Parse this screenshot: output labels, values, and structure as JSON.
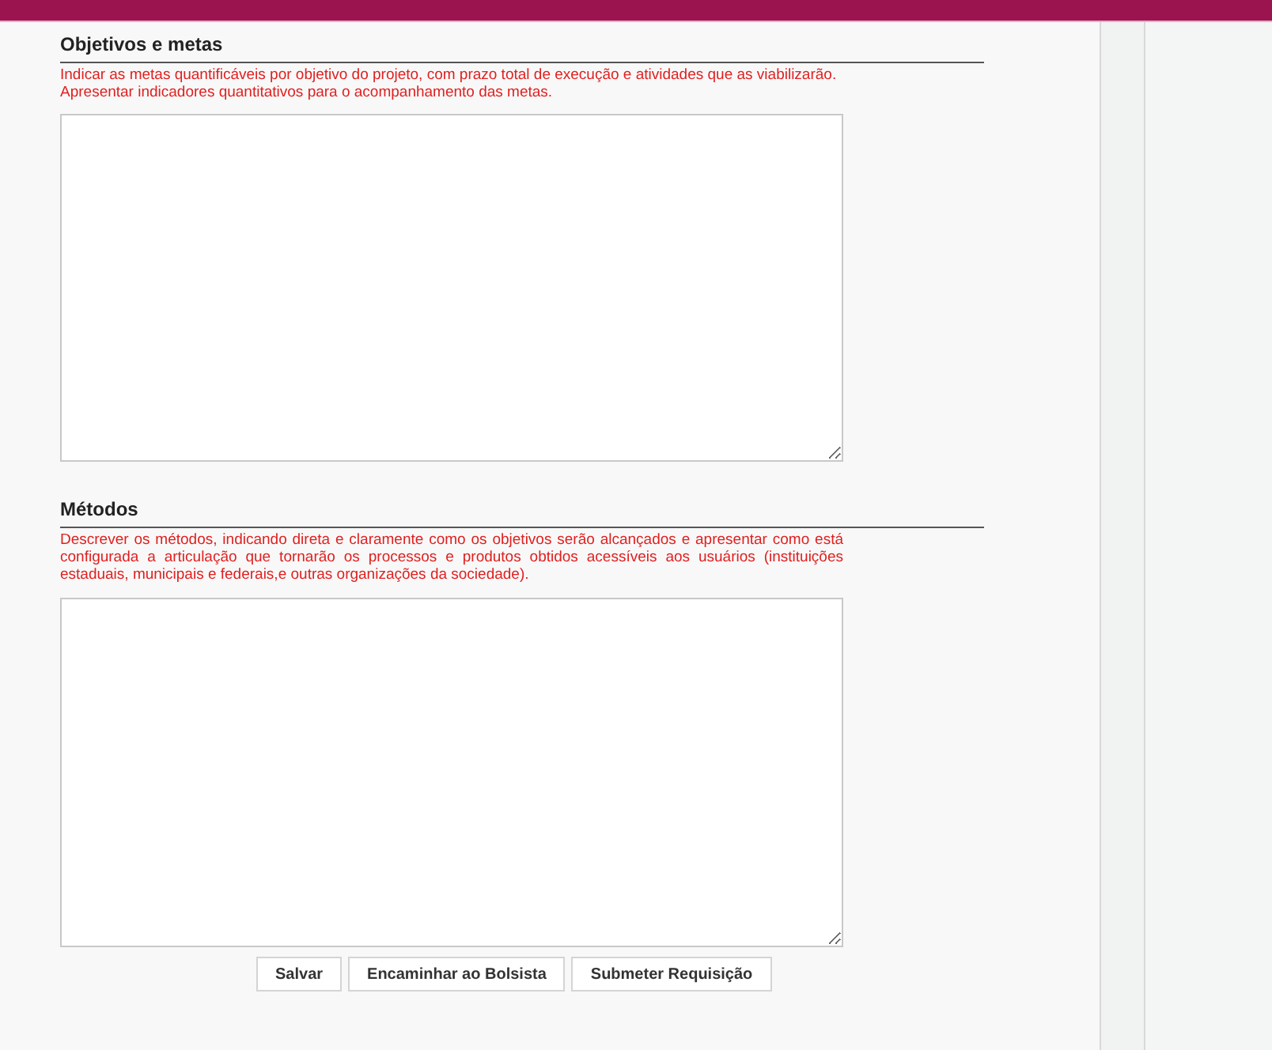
{
  "sections": [
    {
      "title": "Objetivos e metas",
      "hint": "Indicar as metas quantificáveis por objetivo do projeto, com prazo total de execução e atividades que as viabilizarão. Apresentar indicadores quantitativos para o acompanhamento das metas.",
      "justified": false
    },
    {
      "title": "Métodos",
      "hint": "Descrever os métodos, indicando direta e claramente como os objetivos serão alcançados e apresentar como está configurada a articulação que tornarão os processos e produtos obtidos acessíveis aos usuários (instituições estaduais, municipais e federais,e outras organizações da sociedade).",
      "justified": true
    }
  ],
  "buttons": [
    "Salvar",
    "Encaminhar ao Bolsista",
    "Submeter Requisição"
  ]
}
